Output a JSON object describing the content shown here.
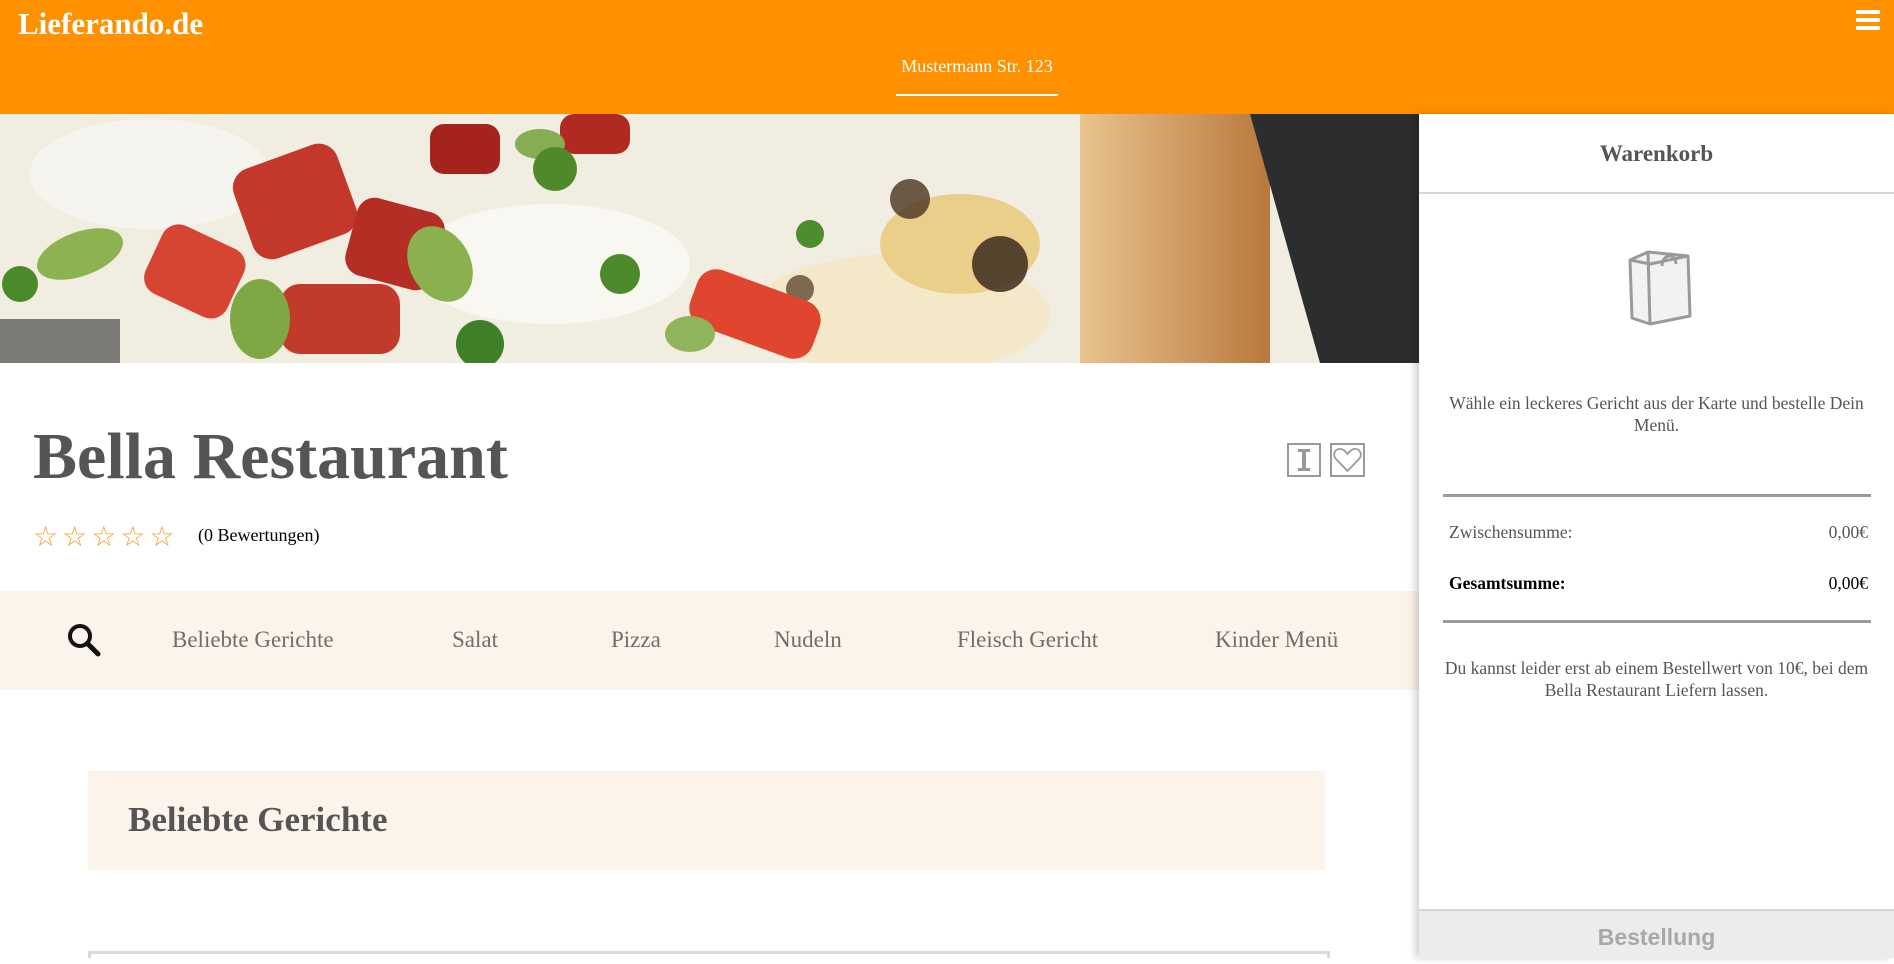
{
  "header": {
    "logo": "Lieferando.de",
    "address": "Mustermann Str. 123",
    "menu_icon": "hamburger-menu-icon",
    "background_color": "#ff9100"
  },
  "hero": {
    "icon": "pizza-hero-image"
  },
  "restaurant": {
    "name": "Bella Restaurant",
    "stars": "☆☆☆☆☆",
    "rating_count": "(0 Bewertungen)",
    "info_icon": "info-icon",
    "favorite_icon": "heart-icon"
  },
  "categories": {
    "search_icon": "search-icon",
    "items": [
      "Beliebte Gerichte",
      "Salat",
      "Pizza",
      "Nudeln",
      "Fleisch Gericht",
      "Kinder Menü"
    ]
  },
  "main": {
    "section_title": "Beliebte Gerichte"
  },
  "cart": {
    "title": "Warenkorb",
    "bag_icon": "shopping-bag-icon",
    "hint": "Wähle ein leckeres Gericht aus der Karte und bestelle Dein Menü.",
    "subtotal_label": "Zwischensumme:",
    "subtotal_value": "0,00€",
    "total_label": "Gesamtsumme:",
    "total_value": "0,00€",
    "min_order_note": "Du kannst leider erst ab einem Bestellwert von 10€, bei dem Bella Restaurant Liefern lassen.",
    "order_button": "Bestellung"
  }
}
